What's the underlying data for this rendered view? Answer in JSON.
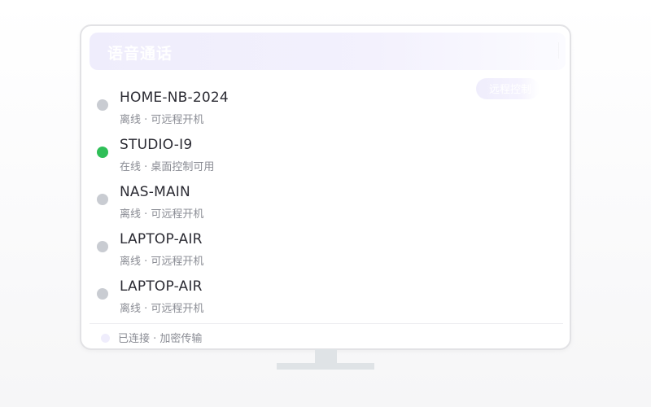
{
  "window": {
    "title": "语音通话"
  },
  "devices": [
    {
      "name": "HOME-NB-2024",
      "status": "离线 · 可远程开机",
      "state": "offline"
    },
    {
      "name": "STUDIO-I9",
      "status": "在线 · 桌面控制可用",
      "state": "online",
      "action_label": "远程控制"
    },
    {
      "name": "NAS-MAIN",
      "status": "离线 · 可远程开机",
      "state": "offline"
    },
    {
      "name": "LAPTOP-AIR",
      "status": "离线 · 可远程开机",
      "state": "offline"
    },
    {
      "name": "LAPTOP-AIR",
      "status": "离线 · 可远程开机",
      "state": "offline"
    }
  ],
  "footer": {
    "status_text": "已连接 · 加密传输"
  },
  "colors": {
    "online": "#2fbf58",
    "offline": "#c9ccd2",
    "accent": "#efedfc"
  }
}
